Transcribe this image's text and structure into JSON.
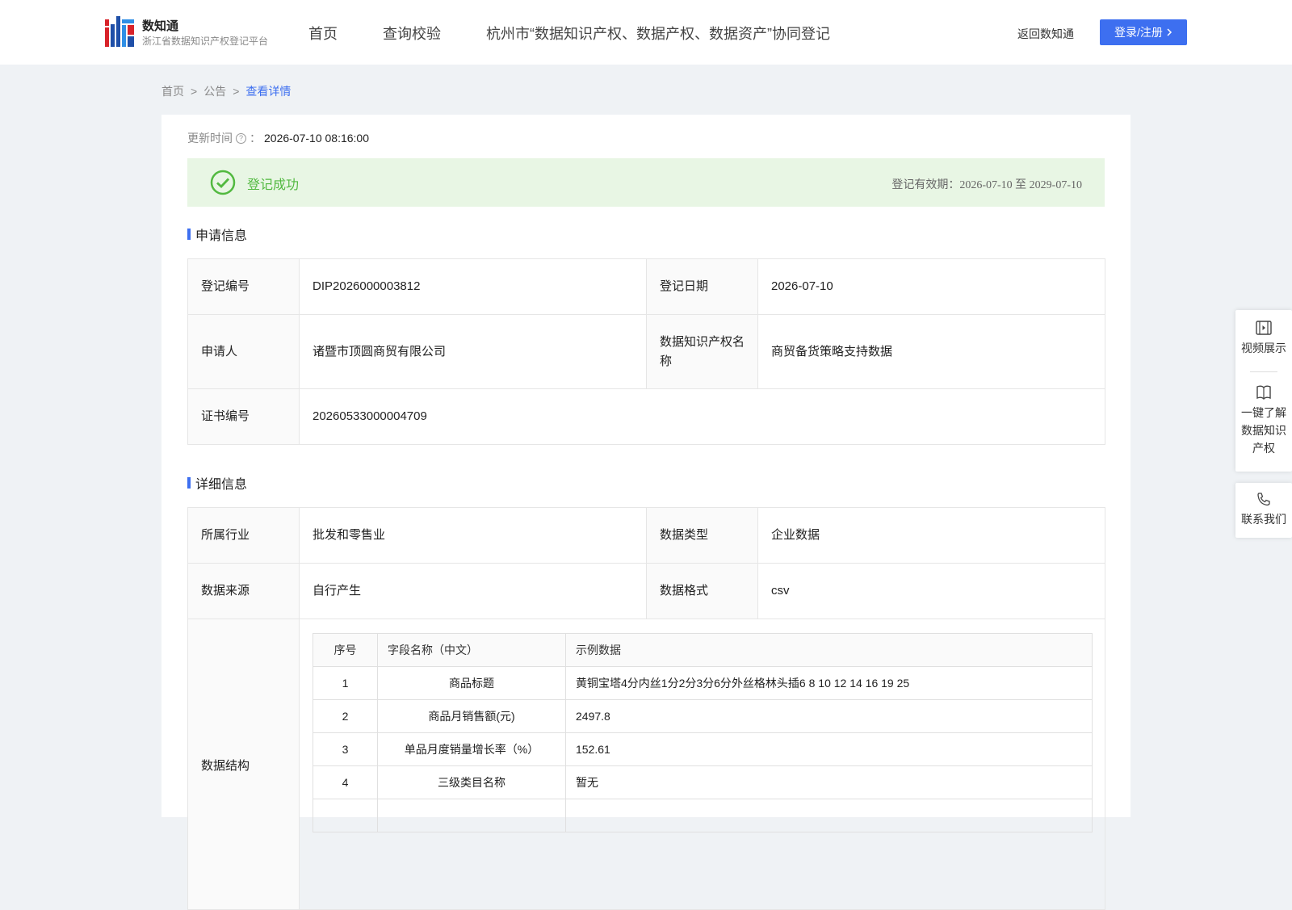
{
  "header": {
    "brand_name": "数知通",
    "brand_sub": "浙江省数据知识产权登记平台",
    "nav": [
      "首页",
      "查询校验",
      "杭州市“数据知识产权、数据产权、数据资产”协同登记"
    ],
    "back_link": "返回数知通",
    "login_label": "登录/注册"
  },
  "breadcrumb": {
    "home": "首页",
    "sep": ">",
    "notice": "公告",
    "current": "查看详情"
  },
  "update": {
    "label": "更新时间",
    "colon": "：",
    "value": "2026-07-10 08:16:00"
  },
  "status": {
    "text": "登记成功",
    "validity": "登记有效期：2026-07-10 至 2029-07-10"
  },
  "apply": {
    "title": "申请信息",
    "reg_no_label": "登记编号",
    "reg_no": "DIP2026000003812",
    "reg_date_label": "登记日期",
    "reg_date": "2026-07-10",
    "applicant_label": "申请人",
    "applicant": "诸暨市顶圆商贸有限公司",
    "ip_name_label": "数据知识产权名称",
    "ip_name": "商贸备货策略支持数据",
    "cert_label": "证书编号",
    "cert_no": "20260533000004709"
  },
  "detail": {
    "title": "详细信息",
    "industry_label": "所属行业",
    "industry": "批发和零售业",
    "type_label": "数据类型",
    "type": "企业数据",
    "source_label": "数据来源",
    "source": "自行产生",
    "format_label": "数据格式",
    "format": "csv",
    "structure_label": "数据结构",
    "columns": [
      "序号",
      "字段名称（中文）",
      "示例数据"
    ],
    "rows": [
      {
        "no": "1",
        "name": "商品标题",
        "sample": "黄铜宝塔4分内丝1分2分3分6分外丝格林头插6 8 10 12 14 16 19 25"
      },
      {
        "no": "2",
        "name": "商品月销售额(元)",
        "sample": "2497.8"
      },
      {
        "no": "3",
        "name": "单品月度销量增长率（%）",
        "sample": "152.61"
      },
      {
        "no": "4",
        "name": "三级类目名称",
        "sample": "暂无"
      }
    ]
  },
  "side": {
    "video": "视频展示",
    "learn": "一键了解数据知识产权",
    "contact": "联系我们"
  },
  "colors": {
    "accent": "#3d6ff0",
    "success": "#52b940",
    "success_bg": "#e8f6e4"
  }
}
